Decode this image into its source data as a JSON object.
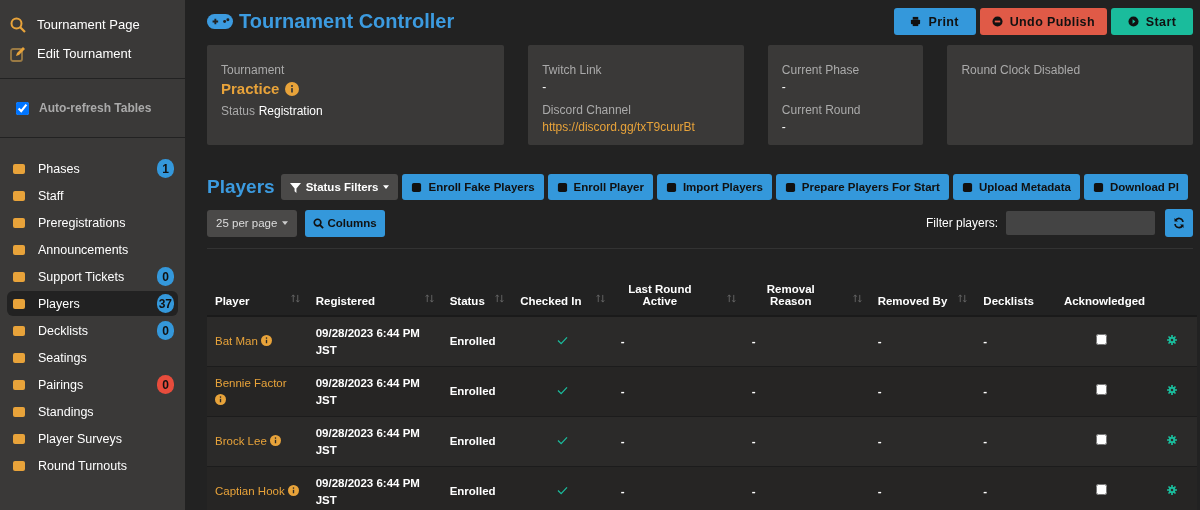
{
  "sidebar": {
    "top_links": [
      {
        "label": "Tournament Page"
      },
      {
        "label": "Edit Tournament"
      }
    ],
    "auto_refresh": {
      "label": "Auto-refresh Tables",
      "checked": true
    },
    "nav": [
      {
        "label": "Phases",
        "badge": "1",
        "color": "#3498db",
        "selected": false
      },
      {
        "label": "Staff",
        "selected": false
      },
      {
        "label": "Preregistrations",
        "selected": false
      },
      {
        "label": "Announcements",
        "selected": false
      },
      {
        "label": "Support Tickets",
        "badge": "0",
        "color": "#3498db",
        "selected": false
      },
      {
        "label": "Players",
        "badge": "37",
        "color": "#3498db",
        "selected": true
      },
      {
        "label": "Decklists",
        "badge": "0",
        "color": "#3498db",
        "selected": false
      },
      {
        "label": "Seatings",
        "selected": false
      },
      {
        "label": "Pairings",
        "badge": "0",
        "color": "#e74c3c",
        "selected": false
      },
      {
        "label": "Standings",
        "selected": false
      },
      {
        "label": "Player Surveys",
        "selected": false
      },
      {
        "label": "Round Turnouts",
        "selected": false
      }
    ]
  },
  "header": {
    "title": "Tournament Controller",
    "buttons": [
      {
        "label": "Print",
        "kind": "primary"
      },
      {
        "label": "Undo Publish",
        "kind": "danger"
      },
      {
        "label": "Start",
        "kind": "success"
      }
    ]
  },
  "info": {
    "tournament_label": "Tournament",
    "tournament_name": "Practice",
    "status_label": "Status",
    "status": "Registration",
    "twitch_label": "Twitch Link",
    "twitch": "-",
    "discord_label": "Discord Channel",
    "discord": "https://discord.gg/txT9cuurBt",
    "phase_label": "Current Phase",
    "phase": "-",
    "round_label": "Current Round",
    "round": "-",
    "clock": "Round Clock Disabled"
  },
  "players": {
    "title": "Players",
    "status_filters": "Status Filters",
    "actions": [
      "Enroll Fake Players",
      "Enroll Player",
      "Import Players",
      "Prepare Players For Start",
      "Upload Metadata",
      "Download Pl"
    ],
    "per_page": "25 per page",
    "columns_button": "Columns",
    "filter_label": "Filter players:",
    "columns": [
      {
        "label": "Player",
        "sortable": true
      },
      {
        "label": "Registered",
        "sortable": true
      },
      {
        "label": "Status",
        "sortable": true
      },
      {
        "label": "Checked In",
        "sortable": true
      },
      {
        "label": "Last Round Active",
        "sortable": true
      },
      {
        "label": "Removal Reason",
        "sortable": true
      },
      {
        "label": "Removed By",
        "sortable": true
      },
      {
        "label": "Decklists",
        "sortable": false
      },
      {
        "label": "Acknowledged",
        "sortable": false
      }
    ],
    "rows": [
      {
        "name": "Bat Man",
        "registered": "09/28/2023 6:44 PM JST",
        "status": "Enrolled",
        "checked_in": true,
        "last_round": "-",
        "removal_reason": "-",
        "removed_by": "-",
        "decklists": "-",
        "acknowledged": false
      },
      {
        "name": "Bennie Factor",
        "registered": "09/28/2023 6:44 PM JST",
        "status": "Enrolled",
        "checked_in": true,
        "last_round": "-",
        "removal_reason": "-",
        "removed_by": "-",
        "decklists": "-",
        "acknowledged": false
      },
      {
        "name": "Brock Lee",
        "registered": "09/28/2023 6:44 PM JST",
        "status": "Enrolled",
        "checked_in": true,
        "last_round": "-",
        "removal_reason": "-",
        "removed_by": "-",
        "decklists": "-",
        "acknowledged": false
      },
      {
        "name": "Captian Hook",
        "registered": "09/28/2023 6:44 PM JST",
        "status": "Enrolled",
        "checked_in": true,
        "last_round": "-",
        "removal_reason": "-",
        "removed_by": "-",
        "decklists": "-",
        "acknowledged": false
      }
    ]
  }
}
